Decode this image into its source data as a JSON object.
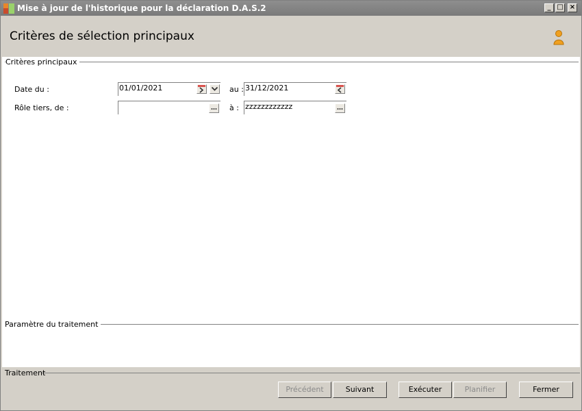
{
  "window": {
    "title": "Mise à jour de l'historique pour la déclaration D.A.S.2",
    "controls": {
      "minimize": "_",
      "maximize": "□",
      "close": "×"
    }
  },
  "header": {
    "title": "Critères de sélection principaux",
    "icon": "user-icon"
  },
  "main_criteria": {
    "label": "Critères principaux",
    "date_from_label": "Date du :",
    "date_from_value": "01/01/2021",
    "date_to_label": "au :",
    "date_to_value": "31/12/2021",
    "role_from_label": "Rôle tiers, de :",
    "role_from_value": "",
    "role_to_label": "à :",
    "role_to_value": "zzzzzzzzzzzz"
  },
  "processing_params": {
    "label": "Paramètre du traitement"
  },
  "footer": {
    "label": "Traitement",
    "buttons": {
      "previous": "Précédent",
      "next": "Suivant",
      "execute": "Exécuter",
      "schedule": "Planifier",
      "close": "Fermer"
    }
  },
  "colors": {
    "titlebar": "#808080",
    "panel": "#ffffff",
    "window_bg": "#d4d0c8",
    "calendar_accent": "#d9534f",
    "user_icon": "#f0a020"
  }
}
